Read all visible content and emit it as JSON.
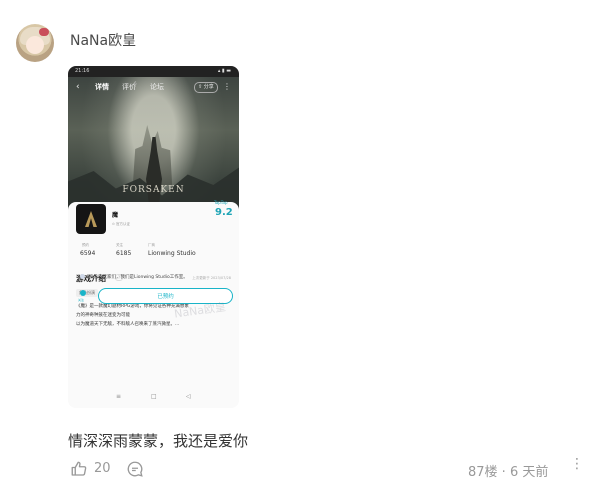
{
  "post": {
    "username": "NaNa欧皇",
    "comment_text": "情深深雨蒙蒙，我还是爱你",
    "like_count": "20",
    "floor_time": "87楼 · 6 天前",
    "more_label": "⋮"
  },
  "screenshot": {
    "status_time": "21:16",
    "status_right": "▴ ▮ ▬",
    "nav": {
      "back": "‹",
      "tabs": [
        "详情",
        "评价",
        "论坛"
      ],
      "review_count_sup": "6",
      "share_label": "⇪ 分享",
      "more": "⋮"
    },
    "hero_title": "FORSAKEN",
    "app": {
      "name": "魔",
      "verified": "⊙ 官方认证",
      "rating_source": "TapTap",
      "score": "9.2"
    },
    "stats": [
      {
        "label": "预约",
        "value": "6594"
      },
      {
        "label": "关注",
        "value": "6185"
      },
      {
        "label": "厂商",
        "value": "Lionwing Studio"
      }
    ],
    "intro": {
      "title": "游戏介绍",
      "badge": "?",
      "date": "上次更新于 2023/07/28",
      "tag": "角色扮演",
      "lines": [
        "《魔》是一款魔幻题材RPG游戏，你将见证各种充满想象",
        "力的神奇种族在迷变为可能",
        "以为魔道天下无敌，不料敌人召唤来了蒸汽微星。..."
      ]
    },
    "notice": "亲爱的玩家们，我们是Lionwing Studio工作室。",
    "follow_label": "关注",
    "followed_button": "已预约",
    "sysnav": [
      "≡",
      "□",
      "◁"
    ],
    "watermark": "NaNa欧皇"
  }
}
